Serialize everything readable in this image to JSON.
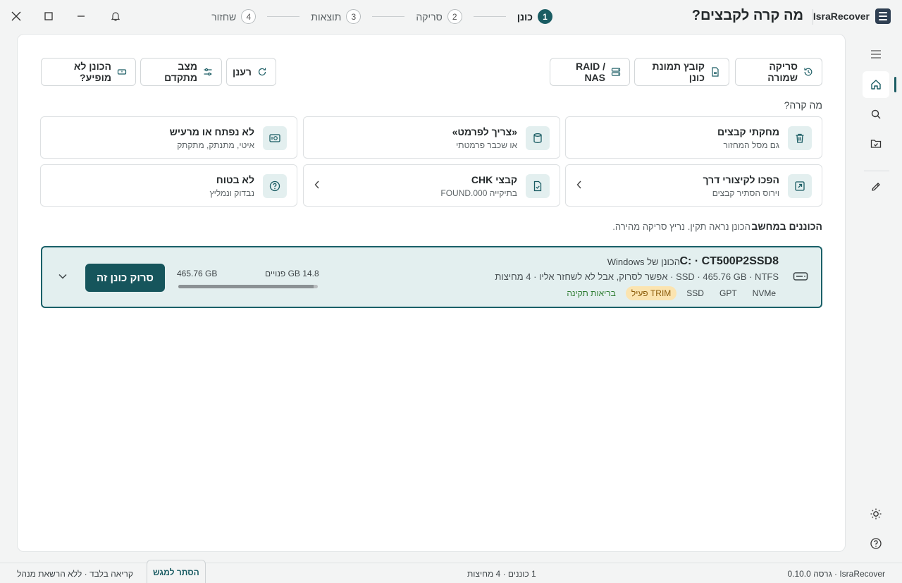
{
  "app": {
    "name": "IsraRecover",
    "page_question": "מה קרה לקבצים?"
  },
  "stepper": [
    {
      "num": "1",
      "label": "כונן",
      "active": true
    },
    {
      "num": "2",
      "label": "סריקה"
    },
    {
      "num": "3",
      "label": "תוצאות"
    },
    {
      "num": "4",
      "label": "שחזור"
    }
  ],
  "toolbar": {
    "saved_scan": "סריקה שמורה",
    "image_file": "קובץ תמונת כונן",
    "raid_nas": "RAID / NAS",
    "refresh": "רענן",
    "advanced": "מצב מתקדם",
    "drive_missing": "הכונן לא מופיע?"
  },
  "what_happened": {
    "label": "מה קרה?",
    "tiles": [
      {
        "title": "מחקתי קבצים",
        "sub": "גם מסל המחזור",
        "icon": "trash-icon"
      },
      {
        "title": "«צריך לפרמט»",
        "sub": "או שכבר פרמטתי",
        "icon": "cylinder-icon"
      },
      {
        "title": "לא נפתח או מרעיש",
        "sub": "איטי, מתנתק, מתקתק",
        "icon": "sound-drive-icon"
      },
      {
        "title": "הפכו לקיצורי דרך",
        "sub": "וירוס הסתיר קבצים",
        "icon": "shortcut-icon"
      },
      {
        "title": "קבצי CHK",
        "sub": "בתיקייה FOUND.000",
        "icon": "file-check-icon"
      },
      {
        "title": "לא בטוח",
        "sub": "נבדוק ונמליץ",
        "icon": "question-icon"
      }
    ]
  },
  "drives": {
    "label": "הכוננים במחשב",
    "hint": "הכונן נראה תקין. נריץ סריקה מהירה.",
    "items": [
      {
        "name": "C: · CT500P2SSD8",
        "owner": "הכונן של Windows",
        "details": "SSD · 465.76 GB · NTFS · אפשר לסרוק, אבל לא לשחזר אליו · 4 מחיצות",
        "chips": [
          "NVMe",
          "GPT",
          "SSD",
          "TRIM פעיל",
          "בריאות תקינה"
        ],
        "free": "14.8 GB פנויים",
        "total": "465.76 GB",
        "used_fraction": 0.968,
        "scan_label": "סרוק כונן זה"
      }
    ]
  },
  "status": {
    "version": "IsraRecover · גרסה 0.10.0",
    "summary": "1 כוננים · 4 מחיצות",
    "mode": "קריאה בלבד · ללא הרשאת מנהל",
    "hide_tab": "הסתר למגש"
  },
  "colors": {
    "accent": "#1a5c63",
    "tile_icon_bg": "#e3efef",
    "trim_chip": "#fbe4b0",
    "health": "#2e7d32"
  }
}
